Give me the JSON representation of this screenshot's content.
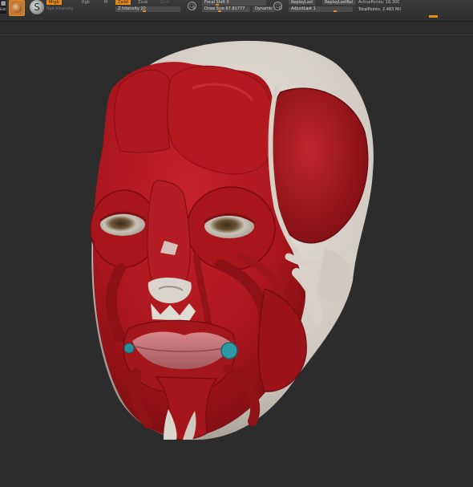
{
  "toolbar": {
    "edit_label": "Edit",
    "mrgb_label": "Mrgb",
    "rgb_label": "Rgb",
    "m_label": "M",
    "zadd_label": "Zadd",
    "zsub_label": "Zsub",
    "zcut_label": "Zcut",
    "rgb_intensity_label": "Rgb Intensity",
    "z_intensity": "Z Intensity 20",
    "focal_shift": "Focal Shift 0",
    "draw_size": "Draw Size 67.81777",
    "dynamic_label": "Dynamic",
    "replay_last": "ReplayLast",
    "replay_last_rel": "ReplayLastRel",
    "adjust_last": "AdjustLast 1",
    "active_points": "ActivePoints: 16,300",
    "total_points": "TotalPoints: 2.483 Mil"
  },
  "colors": {
    "accent": "#e88a1a",
    "muscle": "#b0171d",
    "bone": "#d9d4cc",
    "background": "#2c2c2c"
  }
}
